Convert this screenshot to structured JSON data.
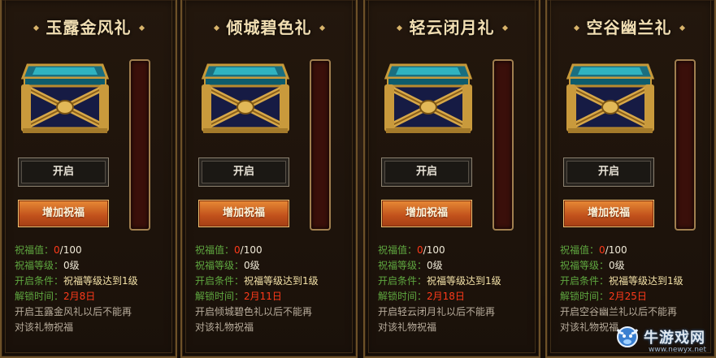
{
  "cards": [
    {
      "title": "玉露金风礼",
      "open_label": "开启",
      "bless_label": "增加祝福",
      "bless_value_label": "祝福值：",
      "bless_value_current": "0",
      "bless_value_max": "/100",
      "bless_level_label": "祝福等级：",
      "bless_level_value": "0级",
      "condition_label": "开启条件：",
      "condition_value": "祝福等级达到1级",
      "unlock_label": "解锁时间：",
      "unlock_value": "2月8日",
      "desc_line1": "开启玉露金风礼以后不能再",
      "desc_line2": "对该礼物祝福",
      "bless_progress": 0
    },
    {
      "title": "倾城碧色礼",
      "open_label": "开启",
      "bless_label": "增加祝福",
      "bless_value_label": "祝福值：",
      "bless_value_current": "0",
      "bless_value_max": "/100",
      "bless_level_label": "祝福等级：",
      "bless_level_value": "0级",
      "condition_label": "开启条件：",
      "condition_value": "祝福等级达到1级",
      "unlock_label": "解锁时间：",
      "unlock_value": "2月11日",
      "desc_line1": "开启倾城碧色礼以后不能再",
      "desc_line2": "对该礼物祝福",
      "bless_progress": 0
    },
    {
      "title": "轻云闭月礼",
      "open_label": "开启",
      "bless_label": "增加祝福",
      "bless_value_label": "祝福值：",
      "bless_value_current": "0",
      "bless_value_max": "/100",
      "bless_level_label": "祝福等级：",
      "bless_level_value": "0级",
      "condition_label": "开启条件：",
      "condition_value": "祝福等级达到1级",
      "unlock_label": "解锁时间：",
      "unlock_value": "2月18日",
      "desc_line1": "开启轻云闭月礼以后不能再",
      "desc_line2": "对该礼物祝福",
      "bless_progress": 0
    },
    {
      "title": "空谷幽兰礼",
      "open_label": "开启",
      "bless_label": "增加祝福",
      "bless_value_label": "祝福值：",
      "bless_value_current": "0",
      "bless_value_max": "/100",
      "bless_level_label": "祝福等级：",
      "bless_level_value": "0级",
      "condition_label": "开启条件：",
      "condition_value": "祝福等级达到1级",
      "unlock_label": "解锁时间：",
      "unlock_value": "2月25日",
      "desc_line1": "开启空谷幽兰礼以后不能再",
      "desc_line2": "对该礼物祝福",
      "bless_progress": 0
    }
  ],
  "watermark": {
    "name": "牛游戏网",
    "url": "www.newyx.net"
  },
  "colors": {
    "label_green": "#5fa840",
    "value_red": "#ff3a1a",
    "button_orange": "#d8692a",
    "frame_gold": "#6d5128"
  }
}
